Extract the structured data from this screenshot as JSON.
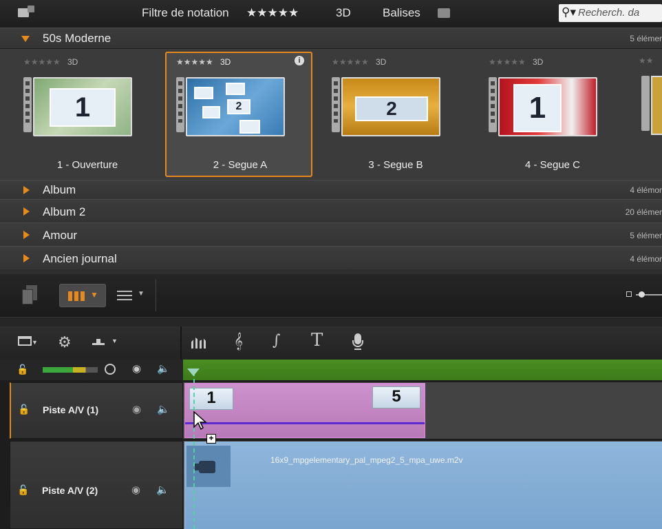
{
  "topbar": {
    "filter_label": "Filtre de notation",
    "filter_stars": "★★★★★",
    "threed_label": "3D",
    "tags_label": "Balises",
    "search_placeholder": "Recherch. da"
  },
  "categories": [
    {
      "name": "50s Moderne",
      "count": "5 élémer",
      "expanded": true
    },
    {
      "name": "Album",
      "count": "4 élémor",
      "expanded": false
    },
    {
      "name": "Album 2",
      "count": "20 élémer",
      "expanded": false
    },
    {
      "name": "Amour",
      "count": "5 élémer",
      "expanded": false
    },
    {
      "name": "Ancien journal",
      "count": "4 élémor",
      "expanded": false
    }
  ],
  "thumbnails": [
    {
      "stars": "★★★★★",
      "tag": "3D",
      "number": "1",
      "name": "1 - Ouverture",
      "selected": false
    },
    {
      "stars": "★★★★★",
      "tag": "3D",
      "number": "2",
      "name": "2 - Segue A",
      "selected": true
    },
    {
      "stars": "★★★★★",
      "tag": "3D",
      "number": "2",
      "name": "3 - Segue B",
      "selected": false
    },
    {
      "stars": "★★★★★",
      "tag": "3D",
      "number": "1",
      "name": "4 - Segue C",
      "selected": false
    }
  ],
  "tools": {
    "text_tool": "T"
  },
  "tracks": [
    {
      "name": "Piste A/V (1)",
      "clip_start": "1",
      "clip_end": "5"
    },
    {
      "name": "Piste A/V (2)",
      "clip_name": "16x9_mpgelementary_pal_mpeg2_5_mpa_uwe.m2v"
    }
  ],
  "colors": {
    "accent": "#e68a1f",
    "master_lane": "#4b8f22",
    "clip_pink": "#c48ac4",
    "clip_blue": "#86aed6"
  }
}
